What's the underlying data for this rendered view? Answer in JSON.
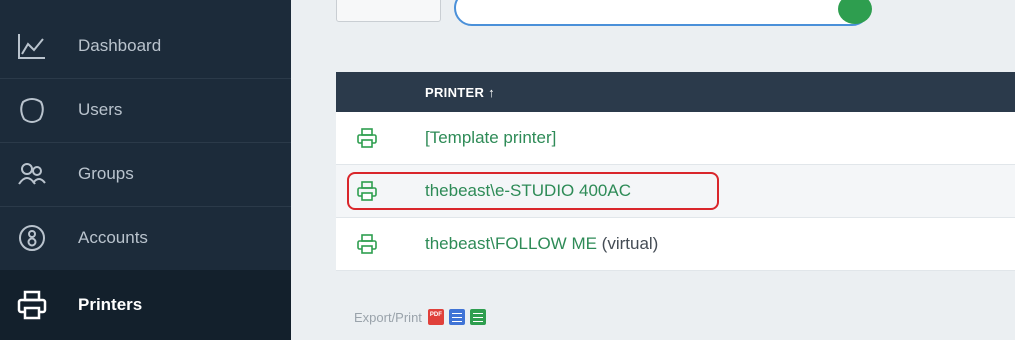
{
  "sidebar": {
    "items": [
      {
        "label": "Dashboard",
        "icon": "chart-line-icon",
        "active": false
      },
      {
        "label": "Users",
        "icon": "user-icon",
        "active": false
      },
      {
        "label": "Groups",
        "icon": "group-icon",
        "active": false
      },
      {
        "label": "Accounts",
        "icon": "account-coin-icon",
        "active": false
      },
      {
        "label": "Printers",
        "icon": "printer-icon",
        "active": true
      }
    ]
  },
  "table": {
    "header": {
      "printer_label": "PRINTER",
      "sort_indicator": "↑"
    },
    "rows": [
      {
        "name": "[Template printer]",
        "suffix": ""
      },
      {
        "name": "thebeast\\e-STUDIO 400AC",
        "suffix": ""
      },
      {
        "name": "thebeast\\FOLLOW ME",
        "suffix": " (virtual)"
      }
    ]
  },
  "export": {
    "label": "Export/Print",
    "pdf_text": "PDF"
  },
  "colors": {
    "sidebar_bg": "#1c2b3a",
    "table_header_bg": "#2b3a4b",
    "link_green": "#2e8b57",
    "highlight_red": "#d9262b"
  }
}
